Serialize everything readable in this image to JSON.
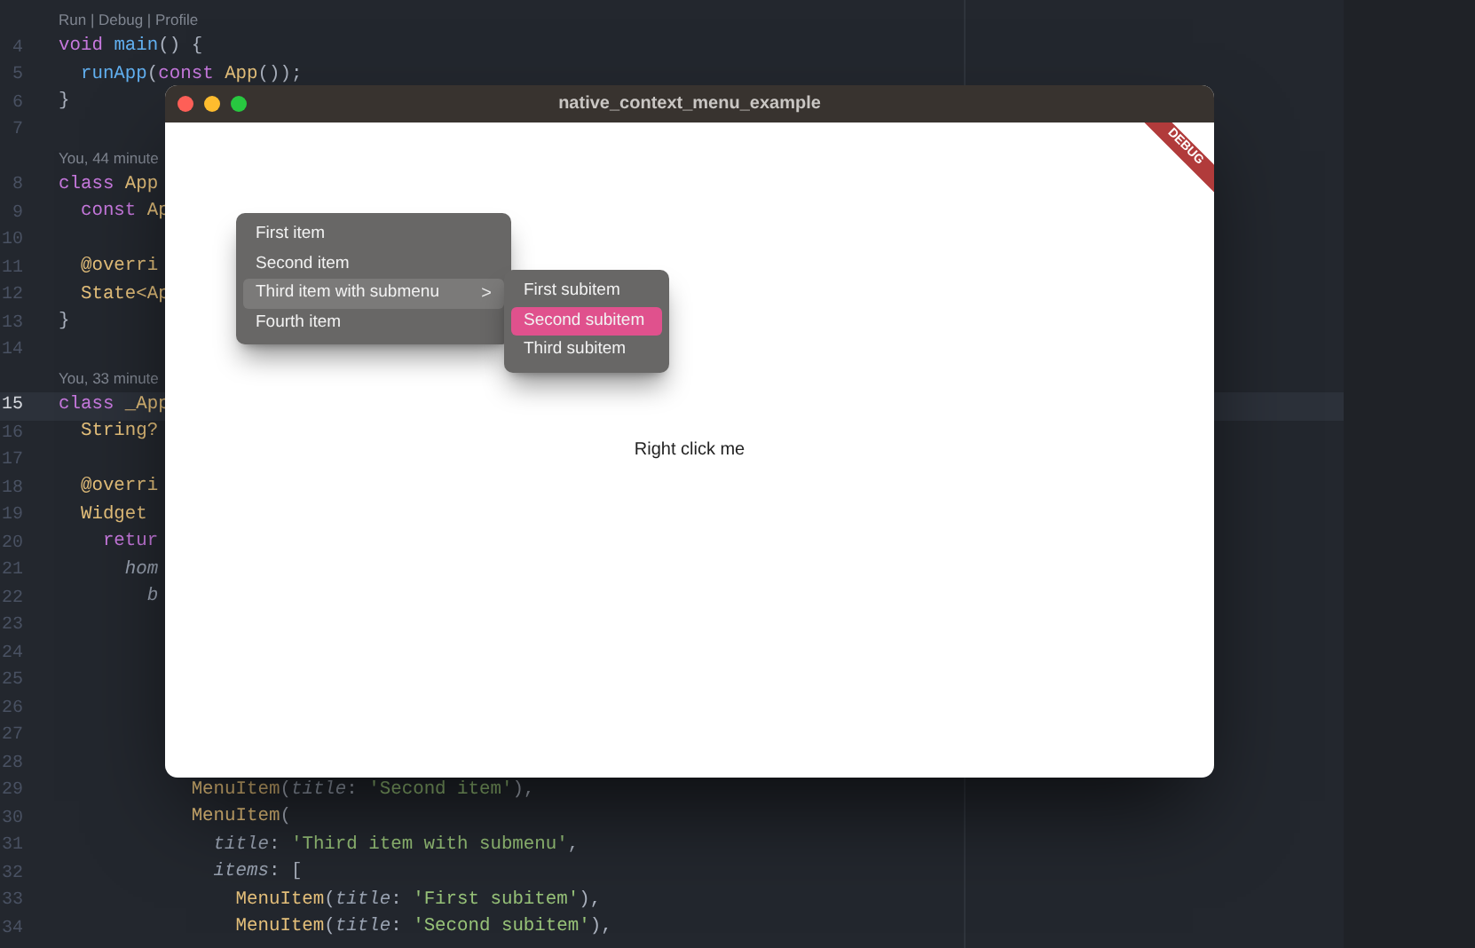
{
  "editor": {
    "lines": [
      {
        "kind": "annotation",
        "text": "Run | Debug | Profile"
      },
      {
        "kind": "code",
        "number": "4",
        "current": false,
        "tokens": [
          {
            "text": "void",
            "kind": "keyword"
          },
          {
            "text": " main",
            "kind": "function"
          },
          {
            "text": "() {",
            "kind": "plain"
          }
        ]
      },
      {
        "kind": "code",
        "number": "5",
        "current": false,
        "tokens": [
          {
            "text": "  runApp",
            "kind": "function"
          },
          {
            "text": "(",
            "kind": "plain"
          },
          {
            "text": "const",
            "kind": "keyword"
          },
          {
            "text": " App",
            "kind": "type"
          },
          {
            "text": "());",
            "kind": "plain"
          }
        ]
      },
      {
        "kind": "code",
        "number": "6",
        "current": false,
        "tokens": [
          {
            "text": "}",
            "kind": "plain"
          }
        ]
      },
      {
        "kind": "code",
        "number": "7",
        "current": false
      },
      {
        "kind": "annotation",
        "text": "You, 44 minute"
      },
      {
        "kind": "code",
        "number": "8",
        "current": false,
        "tokens": [
          {
            "text": "class",
            "kind": "keyword"
          },
          {
            "text": " App",
            "kind": "type"
          }
        ]
      },
      {
        "kind": "code",
        "number": "9",
        "current": false,
        "tokens": [
          {
            "text": "  const",
            "kind": "keyword"
          },
          {
            "text": " Ap",
            "kind": "type"
          }
        ]
      },
      {
        "kind": "code",
        "number": "10",
        "current": false
      },
      {
        "kind": "code",
        "number": "11",
        "current": false,
        "tokens": [
          {
            "text": "  @overri",
            "kind": "type"
          }
        ]
      },
      {
        "kind": "code",
        "number": "12",
        "current": false,
        "tokens": [
          {
            "text": "  State<Ap",
            "kind": "type"
          }
        ]
      },
      {
        "kind": "code",
        "number": "13",
        "current": false,
        "tokens": [
          {
            "text": "}",
            "kind": "plain"
          }
        ]
      },
      {
        "kind": "code",
        "number": "14",
        "current": false
      },
      {
        "kind": "annotation",
        "text": "You, 33 minute"
      },
      {
        "kind": "code",
        "number": "15",
        "current": true,
        "tokens": [
          {
            "text": "class",
            "kind": "keyword"
          },
          {
            "text": " _App",
            "kind": "type"
          }
        ]
      },
      {
        "kind": "code",
        "number": "16",
        "current": false,
        "tokens": [
          {
            "text": "  String?",
            "kind": "type"
          }
        ]
      },
      {
        "kind": "code",
        "number": "17",
        "current": false
      },
      {
        "kind": "code",
        "number": "18",
        "current": false,
        "tokens": [
          {
            "text": "  @overri",
            "kind": "type"
          }
        ]
      },
      {
        "kind": "code",
        "number": "19",
        "current": false,
        "tokens": [
          {
            "text": "  Widget",
            "kind": "type"
          }
        ]
      },
      {
        "kind": "code",
        "number": "20",
        "current": false,
        "tokens": [
          {
            "text": "    retur",
            "kind": "keyword"
          }
        ]
      },
      {
        "kind": "code",
        "number": "21",
        "current": false,
        "tokens": [
          {
            "text": "      hom",
            "kind": "param"
          }
        ]
      },
      {
        "kind": "code",
        "number": "22",
        "current": false,
        "tokens": [
          {
            "text": "        b",
            "kind": "param"
          }
        ]
      },
      {
        "kind": "code",
        "number": "23",
        "current": false
      },
      {
        "kind": "code",
        "number": "24",
        "current": false
      },
      {
        "kind": "code",
        "number": "25",
        "current": false
      },
      {
        "kind": "code",
        "number": "26",
        "current": false
      },
      {
        "kind": "code",
        "number": "27",
        "current": false
      },
      {
        "kind": "code",
        "number": "28",
        "current": false
      },
      {
        "kind": "code",
        "number": "29",
        "current": false,
        "tokens": [
          {
            "text": "            MenuItem",
            "kind": "type"
          },
          {
            "text": "(",
            "kind": "plain"
          },
          {
            "text": "title",
            "kind": "param"
          },
          {
            "text": ": ",
            "kind": "plain"
          },
          {
            "text": "'Second item'",
            "kind": "string"
          },
          {
            "text": "),",
            "kind": "plain"
          }
        ]
      },
      {
        "kind": "code",
        "number": "30",
        "current": false,
        "tokens": [
          {
            "text": "            MenuItem",
            "kind": "type"
          },
          {
            "text": "(",
            "kind": "plain"
          }
        ]
      },
      {
        "kind": "code",
        "number": "31",
        "current": false,
        "tokens": [
          {
            "text": "              title",
            "kind": "param"
          },
          {
            "text": ": ",
            "kind": "plain"
          },
          {
            "text": "'Third item with submenu'",
            "kind": "string"
          },
          {
            "text": ",",
            "kind": "plain"
          }
        ]
      },
      {
        "kind": "code",
        "number": "32",
        "current": false,
        "tokens": [
          {
            "text": "              items",
            "kind": "param"
          },
          {
            "text": ": [",
            "kind": "plain"
          }
        ]
      },
      {
        "kind": "code",
        "number": "33",
        "current": false,
        "tokens": [
          {
            "text": "                MenuItem",
            "kind": "type"
          },
          {
            "text": "(",
            "kind": "plain"
          },
          {
            "text": "title",
            "kind": "param"
          },
          {
            "text": ": ",
            "kind": "plain"
          },
          {
            "text": "'First subitem'",
            "kind": "string"
          },
          {
            "text": "),",
            "kind": "plain"
          }
        ]
      },
      {
        "kind": "code",
        "number": "34",
        "current": false,
        "tokens": [
          {
            "text": "                MenuItem",
            "kind": "type"
          },
          {
            "text": "(",
            "kind": "plain"
          },
          {
            "text": "title",
            "kind": "param"
          },
          {
            "text": ": ",
            "kind": "plain"
          },
          {
            "text": "'Second subitem'",
            "kind": "string"
          },
          {
            "text": "),",
            "kind": "plain"
          }
        ]
      }
    ]
  },
  "app_window": {
    "title": "native_context_menu_example",
    "debug_banner": "DEBUG",
    "body_text": "Right click me",
    "context_menu": {
      "items": [
        {
          "label": "First item",
          "selected": false
        },
        {
          "label": "Second item",
          "selected": false
        },
        {
          "label": "Third item with submenu",
          "selected": true,
          "chevron": ">"
        },
        {
          "label": "Fourth item",
          "selected": false
        }
      ]
    },
    "submenu": {
      "items": [
        {
          "label": "First subitem",
          "selected": false
        },
        {
          "label": "Second subitem",
          "selected": true
        },
        {
          "label": "Third subitem",
          "selected": false
        }
      ]
    }
  }
}
